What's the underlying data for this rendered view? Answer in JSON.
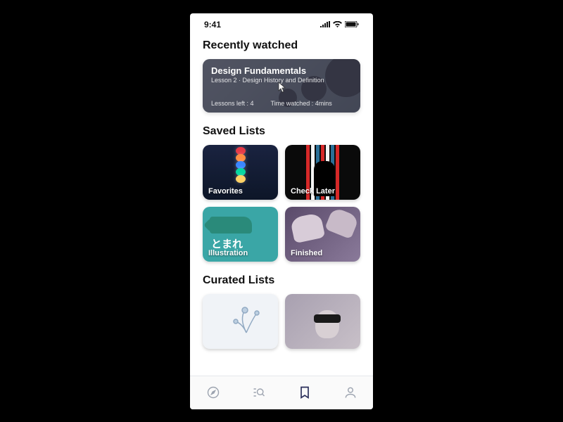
{
  "status": {
    "time": "9:41"
  },
  "recently_watched": {
    "title": "Recently watched",
    "card": {
      "title": "Design Fundamentals",
      "subtitle": "Lesson 2 · Design History and Definition",
      "lessons_left": "Lessons left : 4",
      "time_watched": "Time watched : 4mins"
    }
  },
  "saved_lists": {
    "title": "Saved Lists",
    "tiles": [
      {
        "label": "Favorites"
      },
      {
        "label": "Check Later"
      },
      {
        "label": "Illustration",
        "jp_text": "とまれ"
      },
      {
        "label": "Finished"
      }
    ]
  },
  "curated_lists": {
    "title": "Curated Lists"
  },
  "tabs": [
    "explore",
    "search",
    "bookmarks",
    "profile"
  ],
  "active_tab": "bookmarks"
}
